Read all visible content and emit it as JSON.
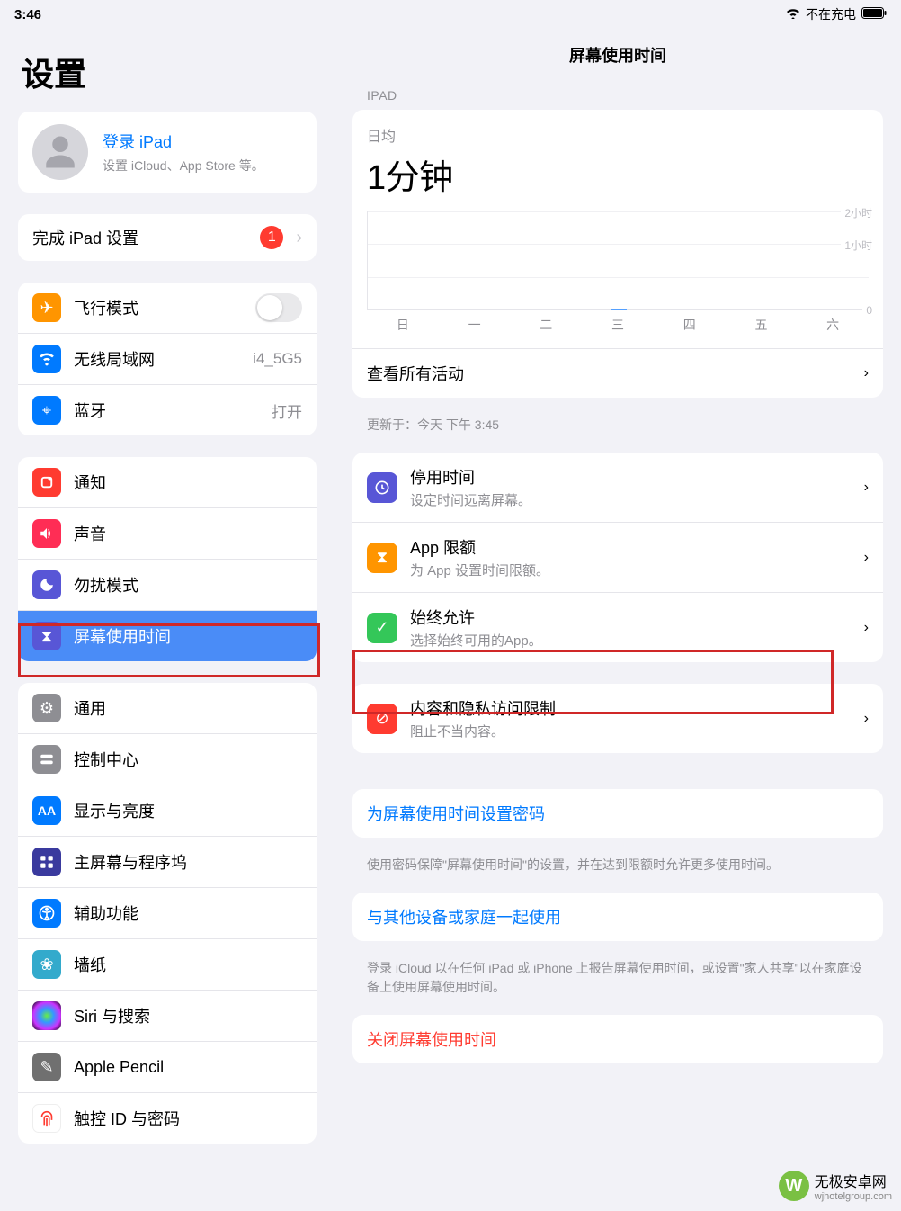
{
  "status": {
    "time": "3:46",
    "charging_text": "不在充电"
  },
  "sidebar": {
    "title": "设置",
    "account": {
      "link": "登录 iPad",
      "sub": "设置 iCloud、App Store 等。"
    },
    "finish_setup": {
      "label": "完成 iPad 设置",
      "badge": "1"
    },
    "group_net": {
      "airplane": "飞行模式",
      "wifi": "无线局域网",
      "wifi_value": "i4_5G5",
      "bt": "蓝牙",
      "bt_value": "打开"
    },
    "group_notif": {
      "notif": "通知",
      "sound": "声音",
      "dnd": "勿扰模式",
      "screentime": "屏幕使用时间"
    },
    "group_general": {
      "general": "通用",
      "control": "控制中心",
      "display": "显示与亮度",
      "home": "主屏幕与程序坞",
      "access": "辅助功能",
      "wallpaper": "墙纸",
      "siri": "Siri 与搜索",
      "pencil": "Apple Pencil",
      "touchid": "触控 ID 与密码"
    }
  },
  "main": {
    "title": "屏幕使用时间",
    "section_ipad": "IPAD",
    "daily_avg_label": "日均",
    "daily_avg_value": "1分钟",
    "see_all": "查看所有活动",
    "updated": "更新于：今天 下午 3:45",
    "rows": {
      "downtime": {
        "title": "停用时间",
        "sub": "设定时间远离屏幕。"
      },
      "limits": {
        "title": "App 限额",
        "sub": "为 App 设置时间限额。"
      },
      "allowed": {
        "title": "始终允许",
        "sub": "选择始终可用的App。"
      },
      "content": {
        "title": "内容和隐私访问限制",
        "sub": "阻止不当内容。"
      }
    },
    "passcode_link": "为屏幕使用时间设置密码",
    "passcode_footer": "使用密码保障\"屏幕使用时间\"的设置，并在达到限额时允许更多使用时间。",
    "share_link": "与其他设备或家庭一起使用",
    "share_footer": "登录 iCloud 以在任何 iPad 或 iPhone 上报告屏幕使用时间，或设置\"家人共享\"以在家庭设备上使用屏幕使用时间。",
    "turnoff": "关闭屏幕使用时间"
  },
  "chart_data": {
    "type": "bar",
    "categories": [
      "日",
      "一",
      "二",
      "三",
      "四",
      "五",
      "六"
    ],
    "values": [
      0,
      0,
      0,
      1,
      0,
      0,
      0
    ],
    "ylabels": [
      "2小时",
      "1小时",
      "0"
    ],
    "ylim": [
      0,
      120
    ],
    "title": "日均",
    "unit": "分钟"
  },
  "watermark": {
    "title": "无极安卓网",
    "sub": "wjhotelgroup.com"
  }
}
